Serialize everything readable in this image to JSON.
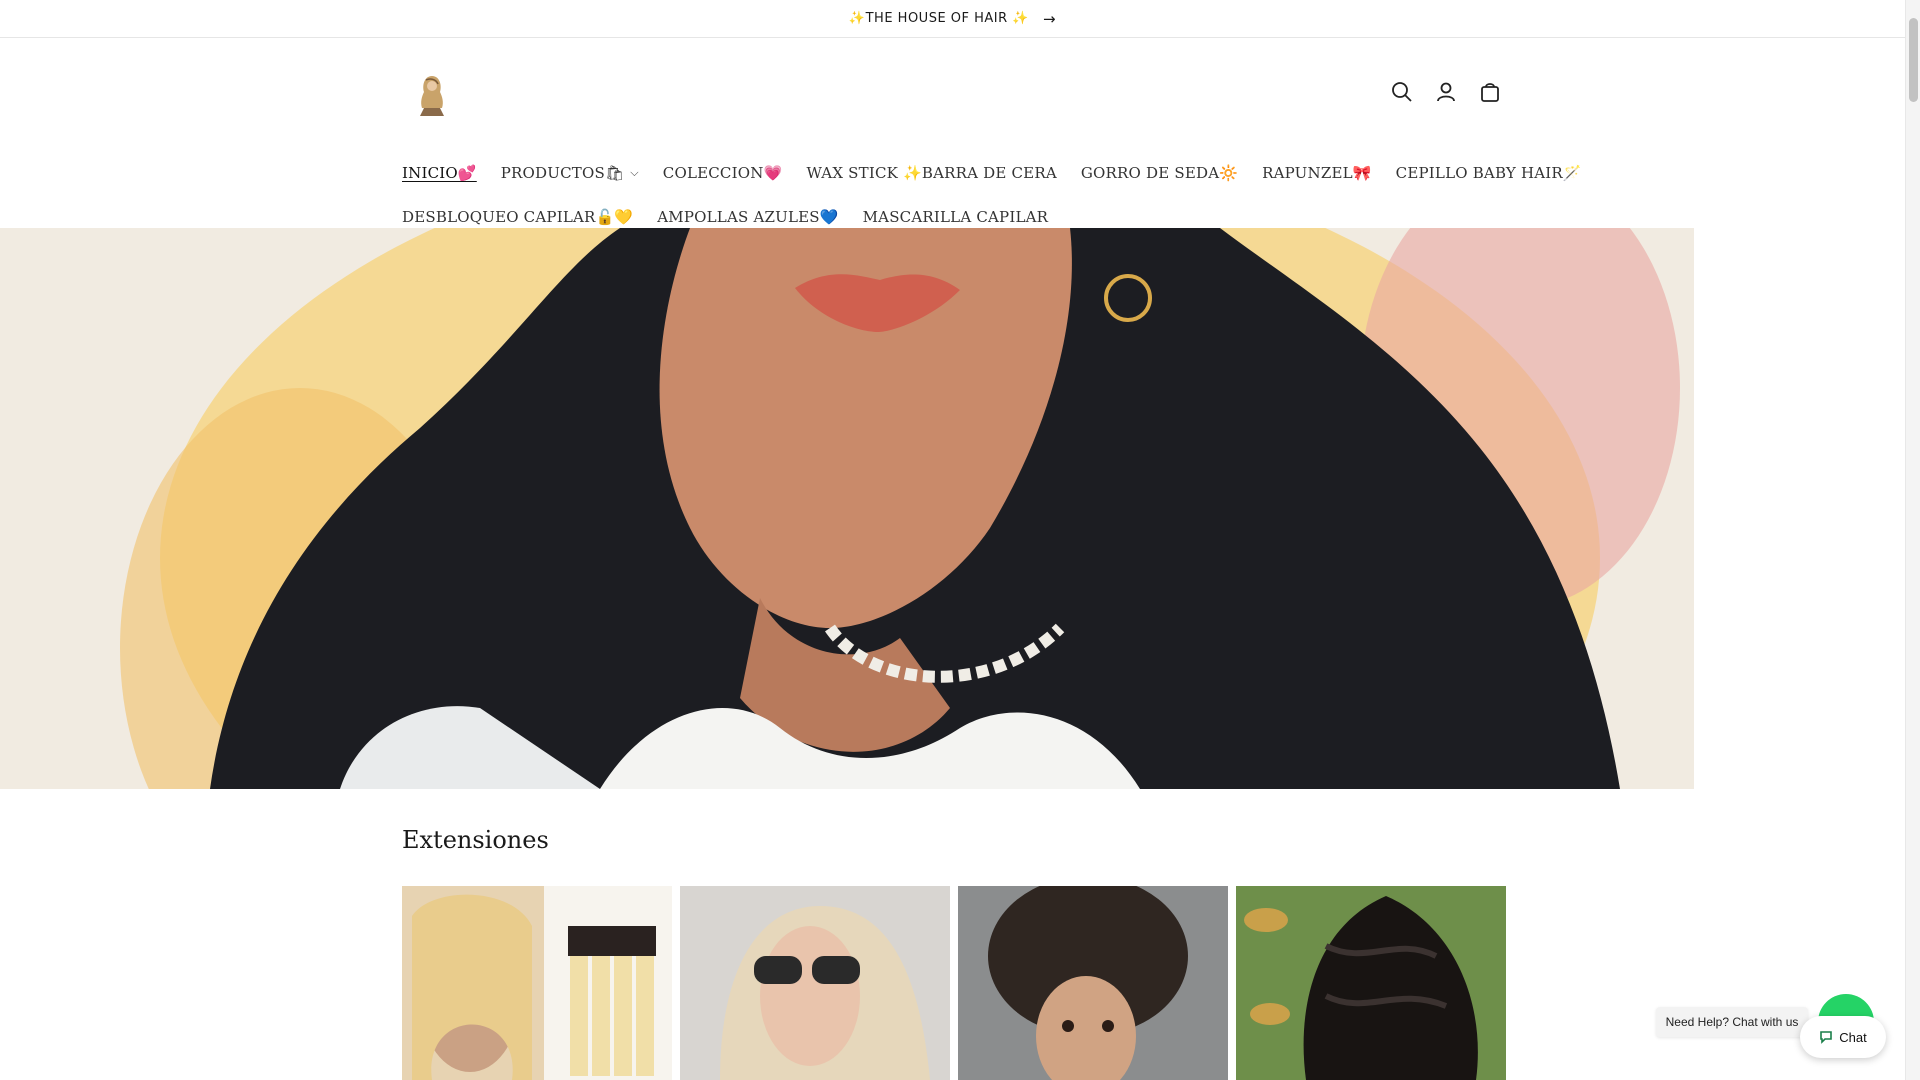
{
  "announcement": {
    "text": "✨THE HOUSE OF HAIR ✨",
    "arrow": "→"
  },
  "header": {
    "logo_icon": "woman-silhouette-logo",
    "icons": [
      "search-icon",
      "account-icon",
      "cart-icon"
    ]
  },
  "nav": {
    "row1": [
      {
        "label": "INICIO💕",
        "active": true
      },
      {
        "label": "PRODUCTOS🛍",
        "has_dropdown": true
      },
      {
        "label": "COLECCION💗"
      },
      {
        "label": "WAX STICK ✨BARRA DE CERA"
      },
      {
        "label": "GORRO DE SEDA🔆"
      },
      {
        "label": "RAPUNZEL🎀"
      },
      {
        "label": "CEPILLO BABY HAIR🪄"
      }
    ],
    "row2": [
      {
        "label": "DESBLOQUEO CAPILAR🔓💛"
      },
      {
        "label": "AMPOLLAS AZULES💙"
      },
      {
        "label": "MASCARILLA CAPILAR"
      }
    ]
  },
  "collection": {
    "title": "Extensiones"
  },
  "chat": {
    "help_text": "Need Help? Chat with us",
    "button_label": "Chat"
  },
  "colors": {
    "accent_green": "#25d366",
    "hero_bg": "#f1ebe1"
  }
}
